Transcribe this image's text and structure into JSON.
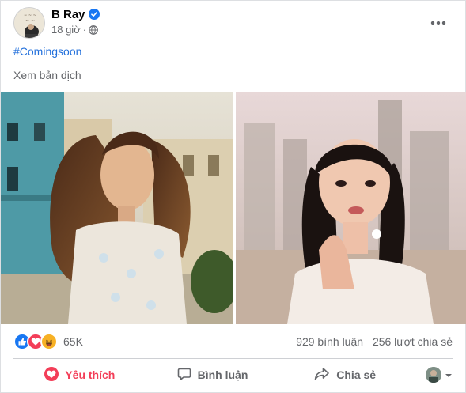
{
  "post": {
    "author": "B Ray",
    "time": "18 giờ",
    "hashtag": "#Comingsoon",
    "translate": "Xem bản dịch",
    "reaction_count": "65K",
    "comments": "929 bình luận",
    "shares": "256 lượt chia sẻ",
    "verified": true
  },
  "actions": {
    "like": "Yêu thích",
    "comment": "Bình luận",
    "share": "Chia sẻ"
  },
  "icons": {
    "verified": "verified-badge-icon",
    "privacy": "globe-icon",
    "more": "more-options-icon",
    "reactions": [
      "like-icon",
      "love-icon",
      "haha-icon"
    ]
  },
  "colors": {
    "link": "#216fdb",
    "like_active": "#f33e58",
    "verified": "#1877f2",
    "secondary_text": "#65676b"
  }
}
